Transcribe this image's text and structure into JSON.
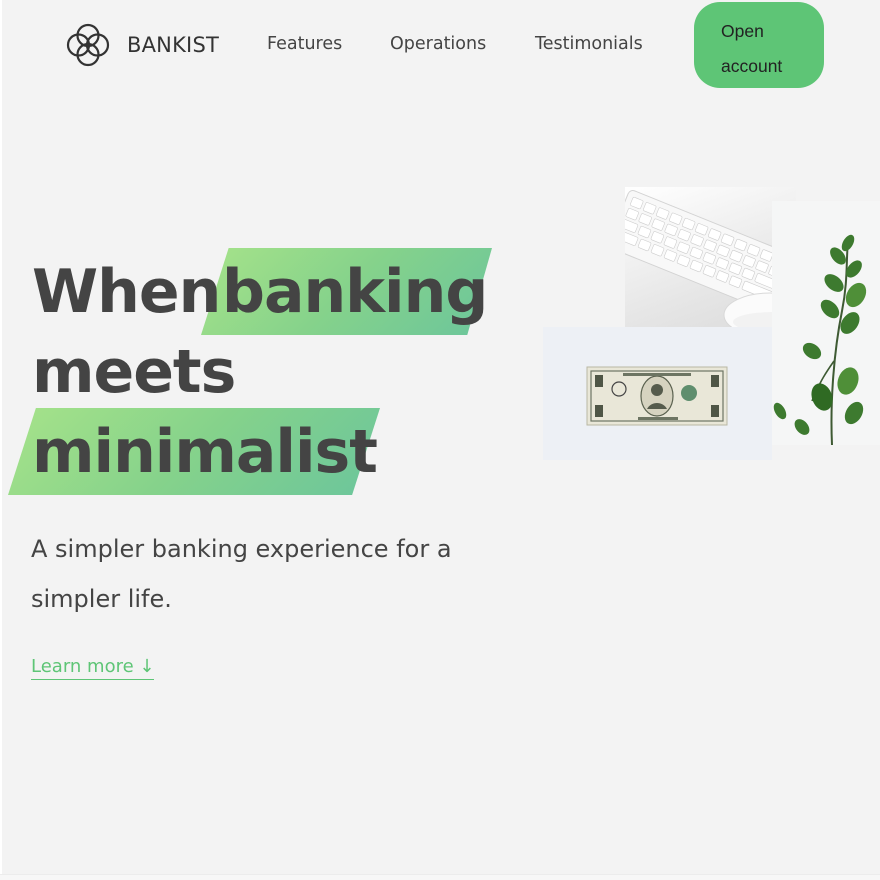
{
  "nav": {
    "brand": "BANKIST",
    "logo_icon": "four-petal-flower-logo",
    "links": [
      "Features",
      "Operations",
      "Testimonials"
    ],
    "cta_line1": "Open",
    "cta_line2": "account"
  },
  "hero": {
    "word1": "When",
    "word2": "banking",
    "word3": "meets",
    "word4": "minimalist",
    "subtitle": "A simpler banking experience for a simpler life.",
    "learn_more": "Learn more ↓"
  },
  "images": {
    "keyboard": "keyboard-and-mouse-photo",
    "plant": "eucalyptus-plant-photo",
    "dollar": "one-dollar-bill-photo"
  },
  "colors": {
    "background": "#f3f3f3",
    "accent_green": "#5ec576",
    "highlight_gradient_start": "#a7e38a",
    "highlight_gradient_end": "#6bc59c",
    "text": "#444444"
  }
}
